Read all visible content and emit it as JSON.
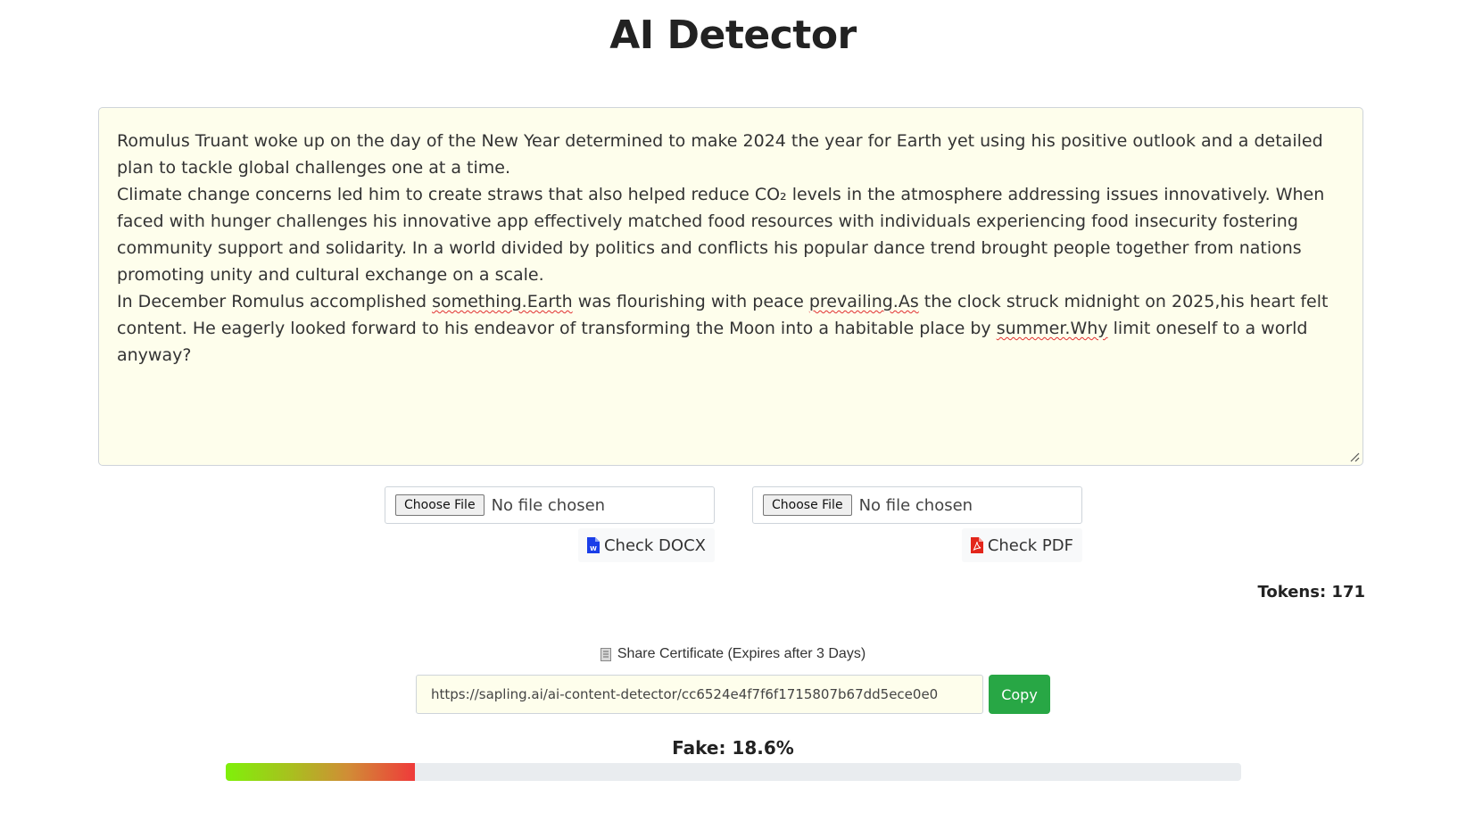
{
  "title": "AI Detector",
  "editor": {
    "lines": [
      [
        {
          "text": "Romulus Truant woke up on the day of the New Year determined to make 2024 the year for Earth yet using his positive outlook and a detailed plan to tackle global challenges one at a time."
        }
      ],
      [
        {
          "text": "Climate change concerns led him to create straws that also helped reduce CO₂ levels in the atmosphere addressing issues innovatively. When faced with hunger challenges his innovative app effectively matched food resources with individuals experiencing food insecurity fostering community support and solidarity. In a world divided by politics and conflicts his popular dance trend brought people together from nations promoting unity and cultural exchange on a scale."
        }
      ],
      [
        {
          "text": "In December Romulus accomplished "
        },
        {
          "text": "something.Earth",
          "flag": true
        },
        {
          "text": " was flourishing with peace "
        },
        {
          "text": "prevailing.As",
          "flag": true
        },
        {
          "text": " the clock struck midnight on 2025,his heart felt content. He eagerly looked forward to his endeavor of transforming the Moon into a habitable place by "
        },
        {
          "text": "summer.Why",
          "flag": true
        },
        {
          "text": " limit oneself to a world anyway?"
        }
      ]
    ]
  },
  "docx_upload": {
    "choose_label": "Choose File",
    "status": "No file chosen",
    "check_label": "Check DOCX",
    "icon": "word-file-icon",
    "icon_color": "#1a3ee8"
  },
  "pdf_upload": {
    "choose_label": "Choose File",
    "status": "No file chosen",
    "check_label": "Check PDF",
    "icon": "pdf-file-icon",
    "icon_color": "#e3261b"
  },
  "tokens_label": "Tokens: 171",
  "share": {
    "label": "Share Certificate (Expires after 3 Days)",
    "icon": "document-icon",
    "url": "https://sapling.ai/ai-content-detector/cc6524e4f7f6f1715807b67dd5ece0e0",
    "copy_label": "Copy",
    "copy_color": "#28a745"
  },
  "result": {
    "label": "Fake: 18.6%",
    "fake_percent": 18.6
  }
}
